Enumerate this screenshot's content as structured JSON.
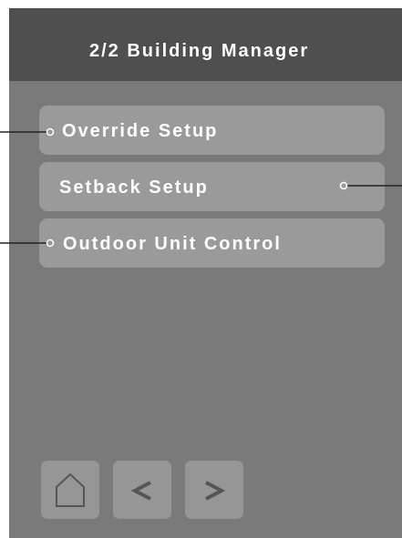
{
  "header": {
    "title": "2/2 Building Manager"
  },
  "menu": {
    "items": [
      {
        "label": "Override Setup"
      },
      {
        "label": "Setback Setup"
      },
      {
        "label": "Outdoor Unit Control"
      }
    ]
  },
  "nav": {
    "home_icon": "home-icon",
    "back_icon": "chevron-left-icon",
    "forward_icon": "chevron-right-icon"
  },
  "colors": {
    "header_bg": "#4f4f4f",
    "screen_bg": "#7a7a7a",
    "button_bg": "#9a9a9a",
    "text": "#ffffff"
  }
}
